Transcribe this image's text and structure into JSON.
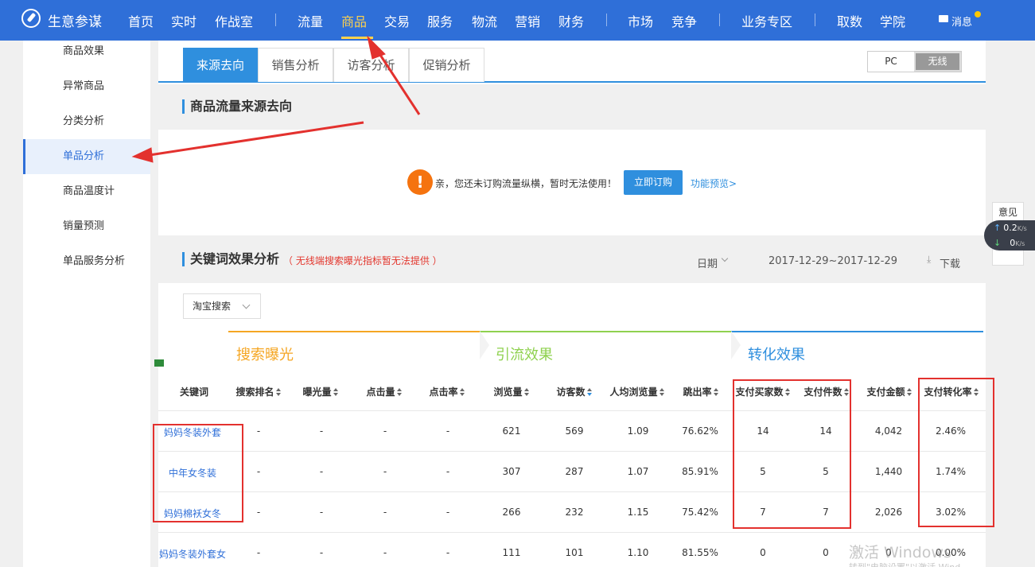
{
  "app": {
    "brand": "生意参谋",
    "nav": [
      "首页",
      "实时",
      "作战室",
      "流量",
      "商品",
      "交易",
      "服务",
      "物流",
      "营销",
      "财务",
      "市场",
      "竞争",
      "业务专区",
      "取数",
      "学院"
    ],
    "active_nav": "商品",
    "messages_label": "消息"
  },
  "sidebar": {
    "items": [
      "商品效果",
      "异常商品",
      "分类分析",
      "单品分析",
      "商品温度计",
      "销量预测",
      "单品服务分析"
    ],
    "active": "单品分析"
  },
  "tabs": {
    "items": [
      "来源去向",
      "销售分析",
      "访客分析",
      "促销分析"
    ],
    "active": "来源去向"
  },
  "device_toggle": {
    "pc": "PC",
    "mobile": "无线",
    "active": "无线"
  },
  "traffic_section": {
    "title": "商品流量来源去向",
    "notice": "亲，您还未订购流量纵横，暂时无法使用！",
    "subscribe_button": "立即订购",
    "preview_link": "功能预览>"
  },
  "keyword_section": {
    "title": "关键词效果分析",
    "note": "（ 无线端搜索曝光指标暂无法提供 ）",
    "date_label": "日期",
    "date_range": "2017-12-29~2017-12-29",
    "download_label": "下载",
    "source_select": "淘宝搜索"
  },
  "table": {
    "groups": [
      {
        "name": "搜索曝光",
        "color": "#f5a623"
      },
      {
        "name": "引流效果",
        "color": "#8fd14f"
      },
      {
        "name": "转化效果",
        "color": "#2f8fde"
      }
    ],
    "headers": [
      "关键词",
      "搜索排名",
      "曝光量",
      "点击量",
      "点击率",
      "浏览量",
      "访客数",
      "人均浏览量",
      "跳出率",
      "支付买家数",
      "支付件数",
      "支付金额",
      "支付转化率"
    ],
    "rows": [
      [
        "妈妈冬装外套",
        "-",
        "-",
        "-",
        "-",
        "621",
        "569",
        "1.09",
        "76.62%",
        "14",
        "14",
        "4,042",
        "2.46%"
      ],
      [
        "中年女冬装",
        "-",
        "-",
        "-",
        "-",
        "307",
        "287",
        "1.07",
        "85.91%",
        "5",
        "5",
        "1,440",
        "1.74%"
      ],
      [
        "妈妈棉袄女冬",
        "-",
        "-",
        "-",
        "-",
        "266",
        "232",
        "1.15",
        "75.42%",
        "7",
        "7",
        "2,026",
        "3.02%"
      ],
      [
        "妈妈冬装外套女",
        "-",
        "-",
        "-",
        "-",
        "111",
        "101",
        "1.10",
        "81.55%",
        "0",
        "0",
        "0",
        "0.00%"
      ]
    ]
  },
  "floating": {
    "feedback": "意见",
    "upload_speed": "0.2",
    "download_speed": "0",
    "speed_unit": "K/s"
  },
  "watermark": {
    "main": "激活 Windows",
    "sub": "转到\"电脑设置\"以激活 Wind"
  },
  "annotation_color": "#e3312e"
}
